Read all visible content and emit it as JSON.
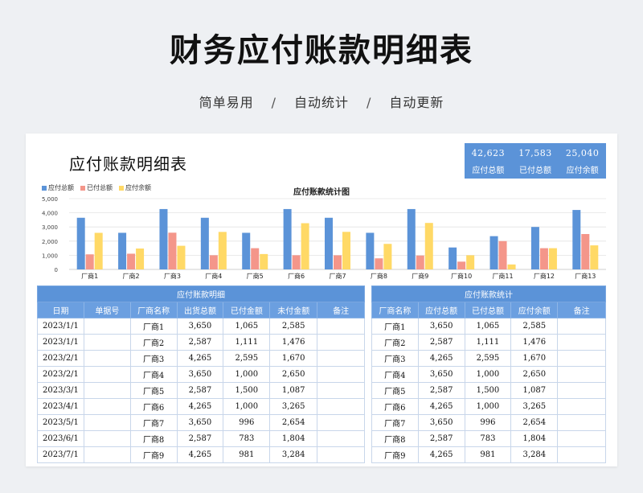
{
  "page": {
    "title": "财务应付账款明细表",
    "subtitle": [
      "简单易用",
      "自动统计",
      "自动更新"
    ],
    "separator": "/"
  },
  "sheet": {
    "title": "应付账款明细表",
    "summary": [
      {
        "value": "42,623",
        "label": "应付总额"
      },
      {
        "value": "17,583",
        "label": "已付总额"
      },
      {
        "value": "25,040",
        "label": "应付余额"
      }
    ]
  },
  "colors": {
    "accent": "#5b93d8",
    "series_blue": "#5b93d8",
    "series_red": "#f4968a",
    "series_yellow": "#ffd966"
  },
  "chart_data": {
    "type": "bar",
    "title": "应付账款统计图",
    "categories": [
      "厂商1",
      "厂商2",
      "厂商3",
      "厂商4",
      "厂商5",
      "厂商6",
      "厂商7",
      "厂商8",
      "厂商9",
      "厂商10",
      "厂商11",
      "厂商12",
      "厂商13"
    ],
    "series": [
      {
        "name": "应付总额",
        "color": "#5b93d8",
        "values": [
          3650,
          2587,
          4265,
          3650,
          2587,
          4265,
          3650,
          2587,
          4265,
          1550,
          2350,
          3000,
          4200
        ]
      },
      {
        "name": "已付总额",
        "color": "#f4968a",
        "values": [
          1065,
          1111,
          2595,
          1000,
          1500,
          1000,
          996,
          783,
          981,
          550,
          2000,
          1500,
          2500
        ]
      },
      {
        "name": "应付余额",
        "color": "#ffd966",
        "values": [
          2585,
          1476,
          1670,
          2650,
          1087,
          3265,
          2654,
          1804,
          3284,
          1000,
          350,
          1500,
          1700
        ]
      }
    ],
    "yticks": [
      "5,000",
      "4,000",
      "3,000",
      "2,000",
      "1,000",
      "0"
    ],
    "ylim": [
      0,
      5000
    ],
    "legend_position": "top-left",
    "grid": true
  },
  "detail": {
    "caption": "应付账款明细",
    "headers": [
      "日期",
      "单据号",
      "厂商名称",
      "出货总额",
      "已付金额",
      "未付金额",
      "备注"
    ],
    "rows": [
      [
        "2023/1/1",
        "",
        "厂商1",
        "3,650",
        "1,065",
        "2,585",
        ""
      ],
      [
        "2023/1/1",
        "",
        "厂商2",
        "2,587",
        "1,111",
        "1,476",
        ""
      ],
      [
        "2023/2/1",
        "",
        "厂商3",
        "4,265",
        "2,595",
        "1,670",
        ""
      ],
      [
        "2023/2/1",
        "",
        "厂商4",
        "3,650",
        "1,000",
        "2,650",
        ""
      ],
      [
        "2023/3/1",
        "",
        "厂商5",
        "2,587",
        "1,500",
        "1,087",
        ""
      ],
      [
        "2023/4/1",
        "",
        "厂商6",
        "4,265",
        "1,000",
        "3,265",
        ""
      ],
      [
        "2023/5/1",
        "",
        "厂商7",
        "3,650",
        "996",
        "2,654",
        ""
      ],
      [
        "2023/6/1",
        "",
        "厂商8",
        "2,587",
        "783",
        "1,804",
        ""
      ],
      [
        "2023/7/1",
        "",
        "厂商9",
        "4,265",
        "981",
        "3,284",
        ""
      ]
    ]
  },
  "stats": {
    "caption": "应付账款统计",
    "headers": [
      "厂商名称",
      "应付总额",
      "已付总额",
      "应付余额",
      "备注"
    ],
    "rows": [
      [
        "厂商1",
        "3,650",
        "1,065",
        "2,585",
        ""
      ],
      [
        "厂商2",
        "2,587",
        "1,111",
        "1,476",
        ""
      ],
      [
        "厂商3",
        "4,265",
        "2,595",
        "1,670",
        ""
      ],
      [
        "厂商4",
        "3,650",
        "1,000",
        "2,650",
        ""
      ],
      [
        "厂商5",
        "2,587",
        "1,500",
        "1,087",
        ""
      ],
      [
        "厂商6",
        "4,265",
        "1,000",
        "3,265",
        ""
      ],
      [
        "厂商7",
        "3,650",
        "996",
        "2,654",
        ""
      ],
      [
        "厂商8",
        "2,587",
        "783",
        "1,804",
        ""
      ],
      [
        "厂商9",
        "4,265",
        "981",
        "3,284",
        ""
      ]
    ]
  }
}
